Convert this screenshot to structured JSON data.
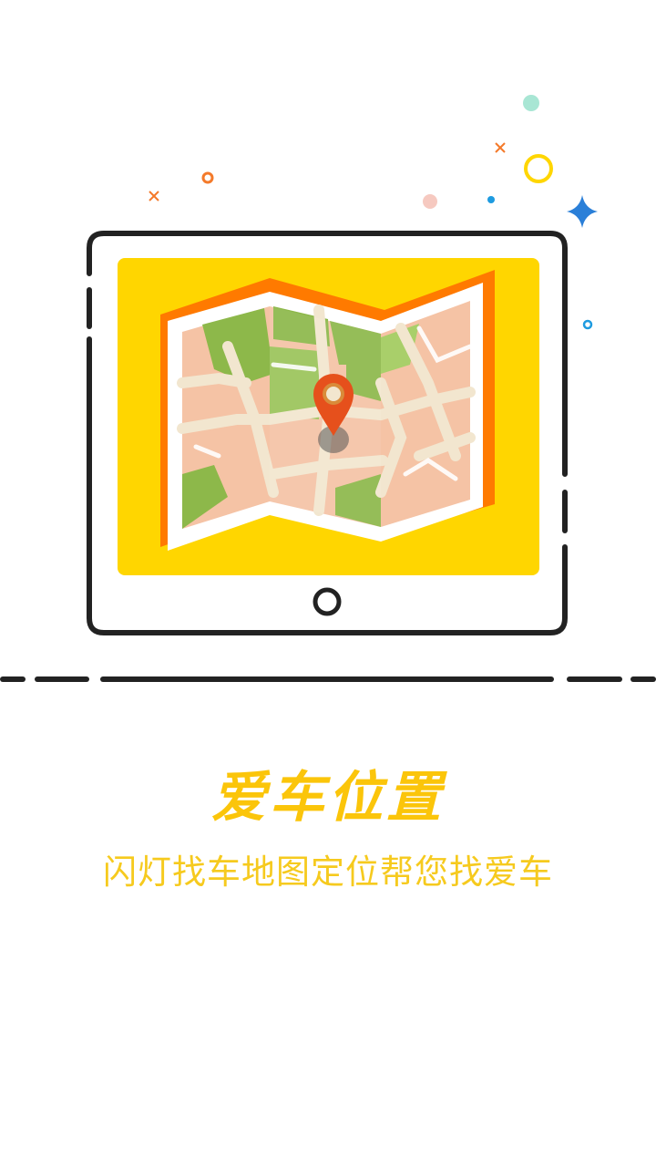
{
  "onboarding": {
    "title": "爱车位置",
    "subtitle": "闪灯找车地图定位帮您找爱车"
  },
  "icons": {
    "tablet": "tablet-icon",
    "map": "folded-map-icon",
    "pin": "location-pin-icon",
    "home_button": "home-button-icon",
    "sparkle": "sparkle-star-icon"
  },
  "colors": {
    "accent": "#FBC50A",
    "screen": "#FFD600",
    "map_frame": "#FF7A00",
    "pin": "#E6501C",
    "park": "#8DB84A",
    "block": "#F5C3A5",
    "road": "#F2E6CF",
    "outline": "#222222"
  }
}
